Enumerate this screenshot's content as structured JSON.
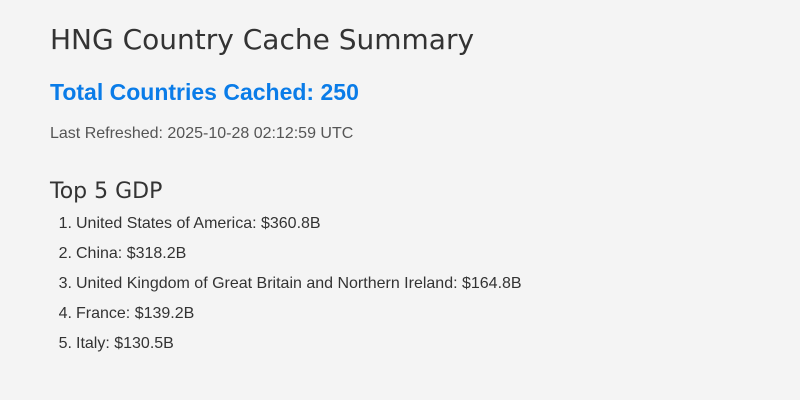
{
  "title": "HNG Country Cache Summary",
  "total_countries": "Total Countries Cached: 250",
  "last_refreshed": "Last Refreshed: 2025-10-28 02:12:59 UTC",
  "top_gdp": {
    "heading": "Top 5 GDP",
    "items": [
      {
        "rank": "1.",
        "text": "United States of America: $360.8B"
      },
      {
        "rank": "2.",
        "text": "China: $318.2B"
      },
      {
        "rank": "3.",
        "text": "United Kingdom of Great Britain and Northern Ireland: $164.8B"
      },
      {
        "rank": "4.",
        "text": "France: $139.2B"
      },
      {
        "rank": "5.",
        "text": "Italy: $130.5B"
      }
    ]
  },
  "colors": {
    "background": "#f4f4f4",
    "text": "#333333",
    "accent": "#0a7ce8",
    "muted": "#555555"
  }
}
